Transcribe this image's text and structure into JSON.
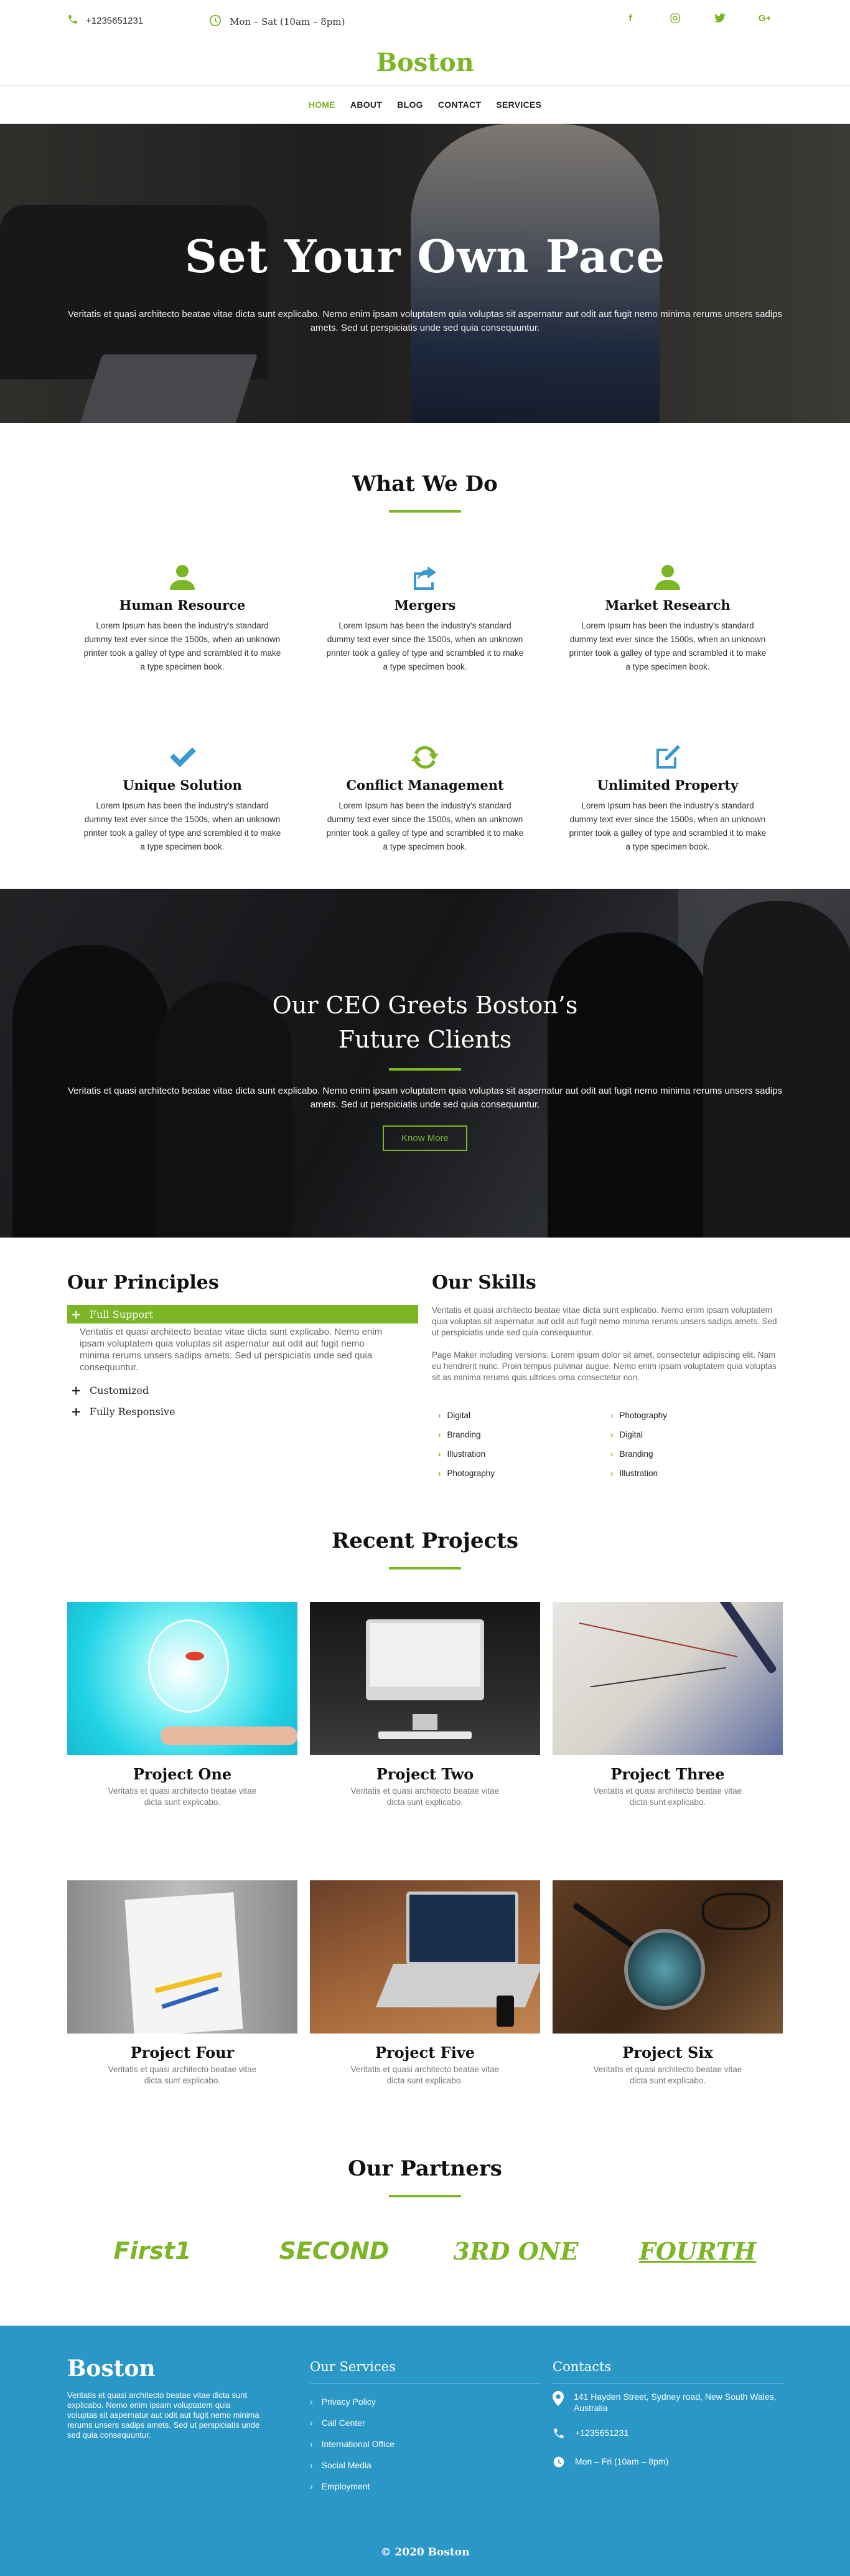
{
  "topbar": {
    "phone": "+1235651231",
    "hours": "Mon – Sat (10am – 8pm)",
    "social_icons": [
      "facebook-icon",
      "instagram-icon",
      "twitter-icon",
      "google-plus-icon"
    ]
  },
  "brand": {
    "name": "Boston",
    "accent": "#7cb526"
  },
  "nav": [
    {
      "label": "HOME",
      "active": true
    },
    {
      "label": "ABOUT"
    },
    {
      "label": "BLOG"
    },
    {
      "label": "CONTACT"
    },
    {
      "label": "SERVICES"
    }
  ],
  "hero": {
    "title": "Set Your Own Pace",
    "text": "Veritatis et quasi architecto beatae vitae dicta sunt explicabo. Nemo enim ipsam voluptatem quia voluptas sit aspernatur aut odit aut fugit nemo minima rerums unsers sadips amets. Sed ut perspiciatis unde sed quia consequuntur."
  },
  "whatwedo": {
    "title": "What We Do",
    "services": [
      {
        "icon": "user-icon",
        "title": "Human Resource",
        "text": "Lorem Ipsum has been the industry's standard dummy text ever since the 1500s, when an unknown printer took a galley of type and scrambled it to make a type specimen book."
      },
      {
        "icon": "share-icon",
        "title": "Mergers",
        "text": "Lorem Ipsum has been the industry's standard dummy text ever since the 1500s, when an unknown printer took a galley of type and scrambled it to make a type specimen book."
      },
      {
        "icon": "user-icon",
        "title": "Market Research",
        "text": "Lorem Ipsum has been the industry's standard dummy text ever since the 1500s, when an unknown printer took a galley of type and scrambled it to make a type specimen book."
      },
      {
        "icon": "check-icon",
        "title": "Unique Solution",
        "text": "Lorem Ipsum has been the industry's standard dummy text ever since the 1500s, when an unknown printer took a galley of type and scrambled it to make a type specimen book."
      },
      {
        "icon": "refresh-icon",
        "title": "Conflict Management",
        "text": "Lorem Ipsum has been the industry's standard dummy text ever since the 1500s, when an unknown printer took a galley of type and scrambled it to make a type specimen book."
      },
      {
        "icon": "edit-icon",
        "title": "Unlimited Property",
        "text": "Lorem Ipsum has been the industry's standard dummy text ever since the 1500s, when an unknown printer took a galley of type and scrambled it to make a type specimen book."
      }
    ]
  },
  "ceo": {
    "title_line1": "Our CEO Greets Boston’s",
    "title_line2": "Future Clients",
    "text": "Veritatis et quasi architecto beatae vitae dicta sunt explicabo. Nemo enim ipsam voluptatem quia voluptas sit aspernatur aut odit aut fugit nemo minima rerums unsers sadips amets. Sed ut perspiciatis unde sed quia consequuntur.",
    "button": "Know More"
  },
  "principles": {
    "title": "Our Principles",
    "items": [
      {
        "label": "Full Support",
        "open": true,
        "body": "Veritatis et quasi architecto beatae vitae dicta sunt explicabo. Nemo enim ipsam voluptatem quia voluptas sit aspernatur aut odit aut fugit nemo minima rerums unsers sadips amets. Sed ut perspiciatis unde sed quia consequuntur."
      },
      {
        "label": "Customized",
        "open": false
      },
      {
        "label": "Fully Responsive",
        "open": false
      }
    ]
  },
  "skills": {
    "title": "Our Skills",
    "para1": "Veritatis et quasi architecto beatae vitae dicta sunt explicabo. Nemo enim ipsam voluptatem quia voluptas sit aspernatur aut odit aut fugit nemo minima rerums unsers sadips amets. Sed ut perspiciatis unde sed quia consequuntur.",
    "para2": "Page Maker including versions. Lorem ipsum dolor sit amet, consectetur adipiscing elit. Nam eu hendrerit nunc. Proin tempus pulvinar augue. Nemo enim ipsam voluptatem quia voluptas sit as minima rerums quis ultrices orna consectetur non.",
    "list_left": [
      "Digital",
      "Branding",
      "Illustration",
      "Photography"
    ],
    "list_right": [
      "Photography",
      "Digital",
      "Branding",
      "Illustration"
    ]
  },
  "projects": {
    "title": "Recent Projects",
    "items": [
      {
        "title": "Project One",
        "text": "Veritatis et quasi architecto beatae vitae dicta sunt explicabo."
      },
      {
        "title": "Project Two",
        "text": "Veritatis et quasi architecto beatae vitae dicta sunt explicabo."
      },
      {
        "title": "Project Three",
        "text": "Veritatis et quasi architecto beatae vitae dicta sunt explicabo."
      },
      {
        "title": "Project Four",
        "text": "Veritatis et quasi architecto beatae vitae dicta sunt explicabo."
      },
      {
        "title": "Project Five",
        "text": "Veritatis et quasi architecto beatae vitae dicta sunt explicabo."
      },
      {
        "title": "Project Six",
        "text": "Veritatis et quasi architecto beatae vitae dicta sunt explicabo."
      }
    ]
  },
  "partners": {
    "title": "Our Partners",
    "logos": [
      "First1",
      "SECOND",
      "3RD ONE",
      "FOURTH"
    ]
  },
  "footer": {
    "brand": "Boston",
    "about": "Veritatis et quasi architecto beatae vitae dicta sunt explicabo. Nemo enim ipsam voluptatem quia voluptas sit aspernatur aut odit aut fugit nemo minima rerums unsers sadips amets. Sed ut perspiciatis unde sed quia consequuntur.",
    "services_title": "Our Services",
    "services": [
      "Privacy Policy",
      "Call Center",
      "International Office",
      "Social Media",
      "Employment"
    ],
    "contacts_title": "Contacts",
    "address": "141 Hayden Street, Sydney road, New South Wales, Australia",
    "phone": "+1235651231",
    "hours": "Mon – Fri (10am – 8pm)",
    "copyright": "© 2020 Boston",
    "color": "#2a97c6"
  }
}
